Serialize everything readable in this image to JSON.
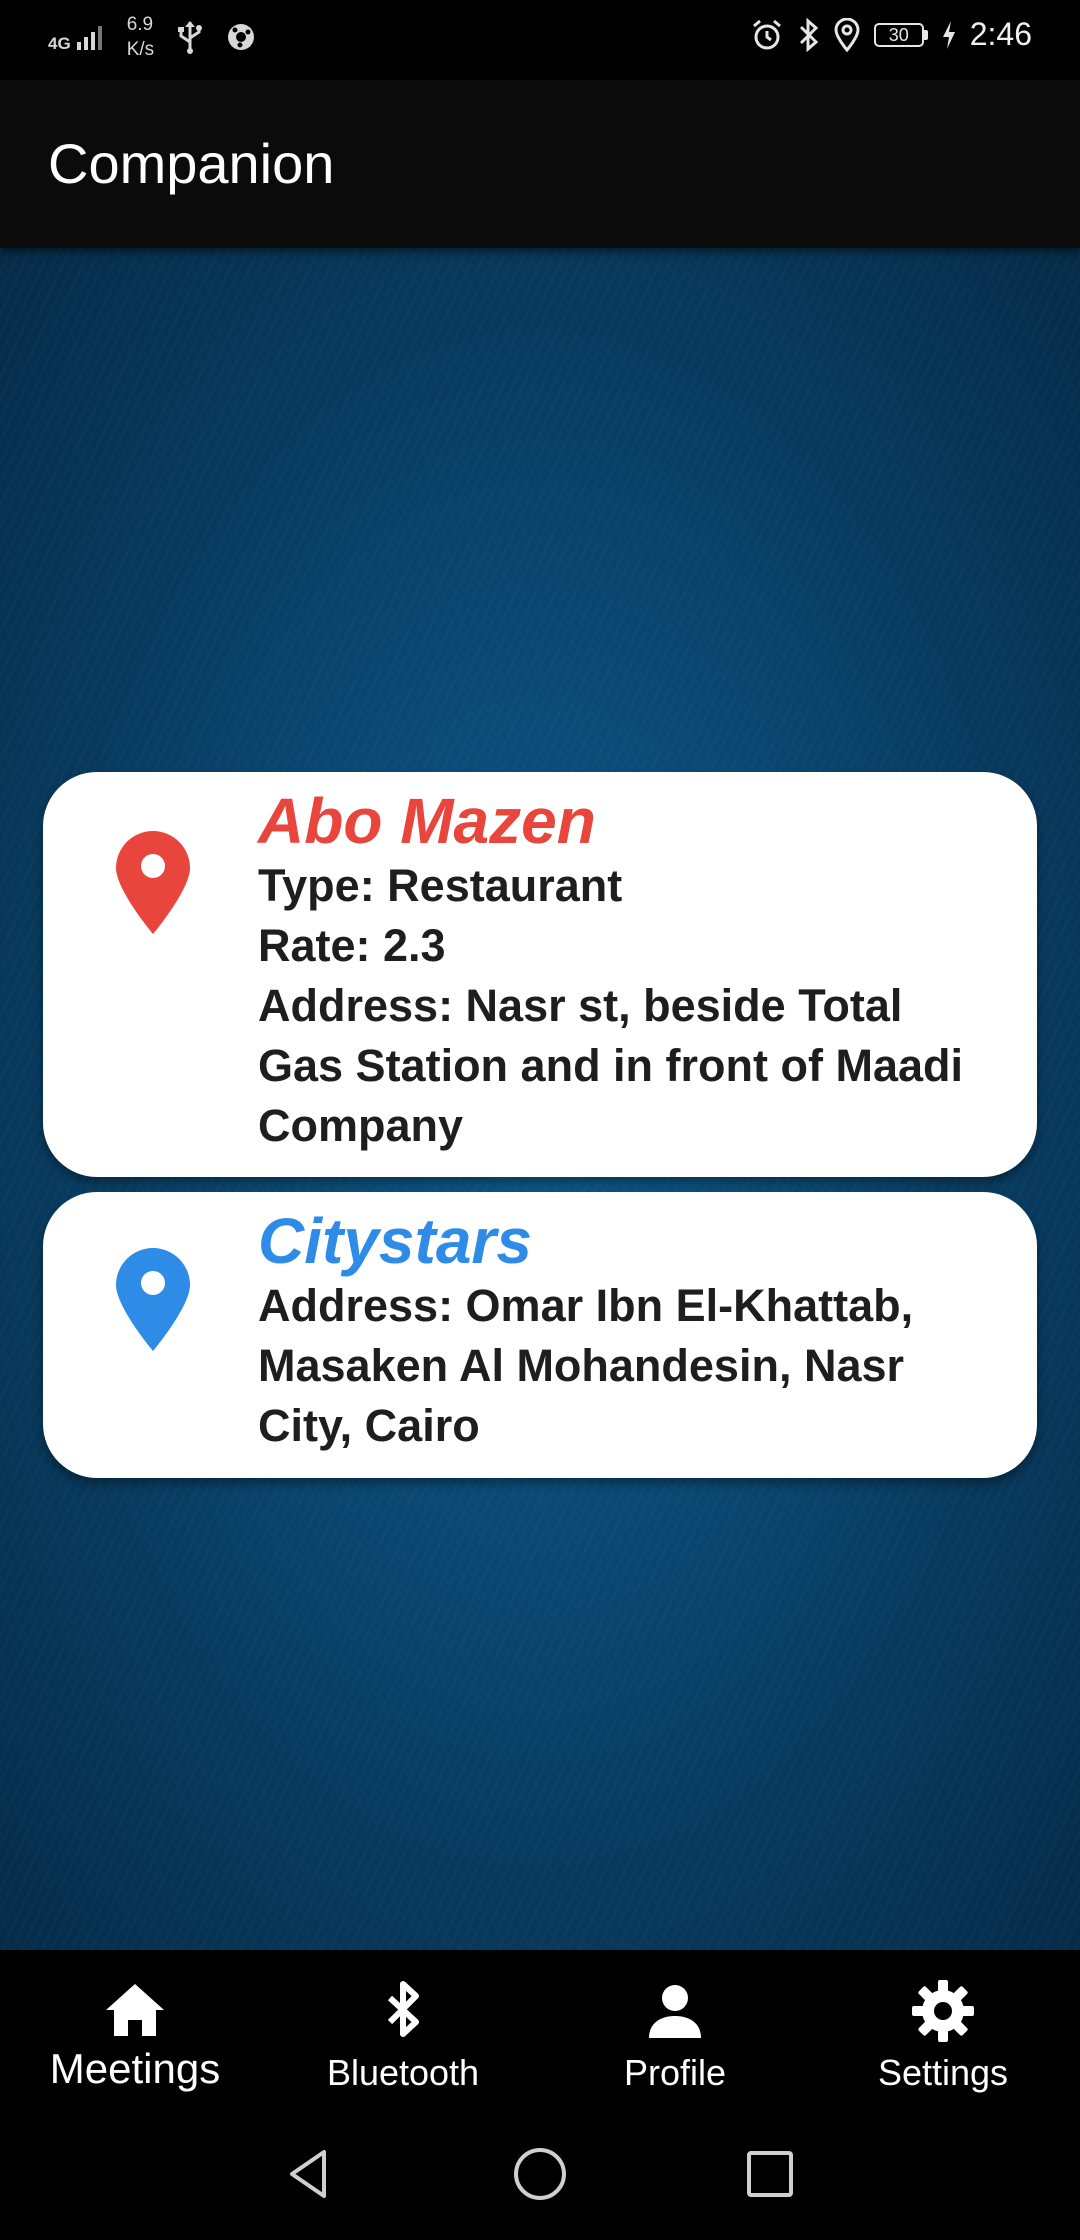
{
  "status_bar": {
    "network_type": "4G",
    "speed_value": "6.9",
    "speed_unit": "K/s",
    "battery_level": "30",
    "time": "2:46",
    "icons_left": [
      "signal-icon",
      "usb-icon",
      "sync-icon"
    ],
    "icons_right": [
      "alarm-icon",
      "bluetooth-icon",
      "location-icon",
      "battery-icon",
      "charging-icon"
    ]
  },
  "app_bar": {
    "title": "Companion"
  },
  "places": [
    {
      "name": "Abo Mazen",
      "pin_color": "#e8453c",
      "lines": [
        "Type: Restaurant",
        "Rate: 2.3",
        "Address: Nasr st, beside Total Gas Station and in front of Maadi Company"
      ]
    },
    {
      "name": "Citystars",
      "pin_color": "#2e8be6",
      "lines": [
        "Address: Omar Ibn El-Khattab, Masaken Al Mohandesin, Nasr City, Cairo"
      ]
    }
  ],
  "bottom_nav": {
    "items": [
      {
        "label": "Meetings",
        "icon": "home-icon",
        "active": true
      },
      {
        "label": "Bluetooth",
        "icon": "bluetooth-icon",
        "active": false
      },
      {
        "label": "Profile",
        "icon": "person-icon",
        "active": false
      },
      {
        "label": "Settings",
        "icon": "gear-icon",
        "active": false
      }
    ]
  },
  "system_nav": {
    "buttons": [
      "back-icon",
      "home-circle-icon",
      "recents-icon"
    ]
  },
  "colors": {
    "background_blue": "#0b4a75",
    "card": "#ffffff",
    "bars": "#000000"
  }
}
